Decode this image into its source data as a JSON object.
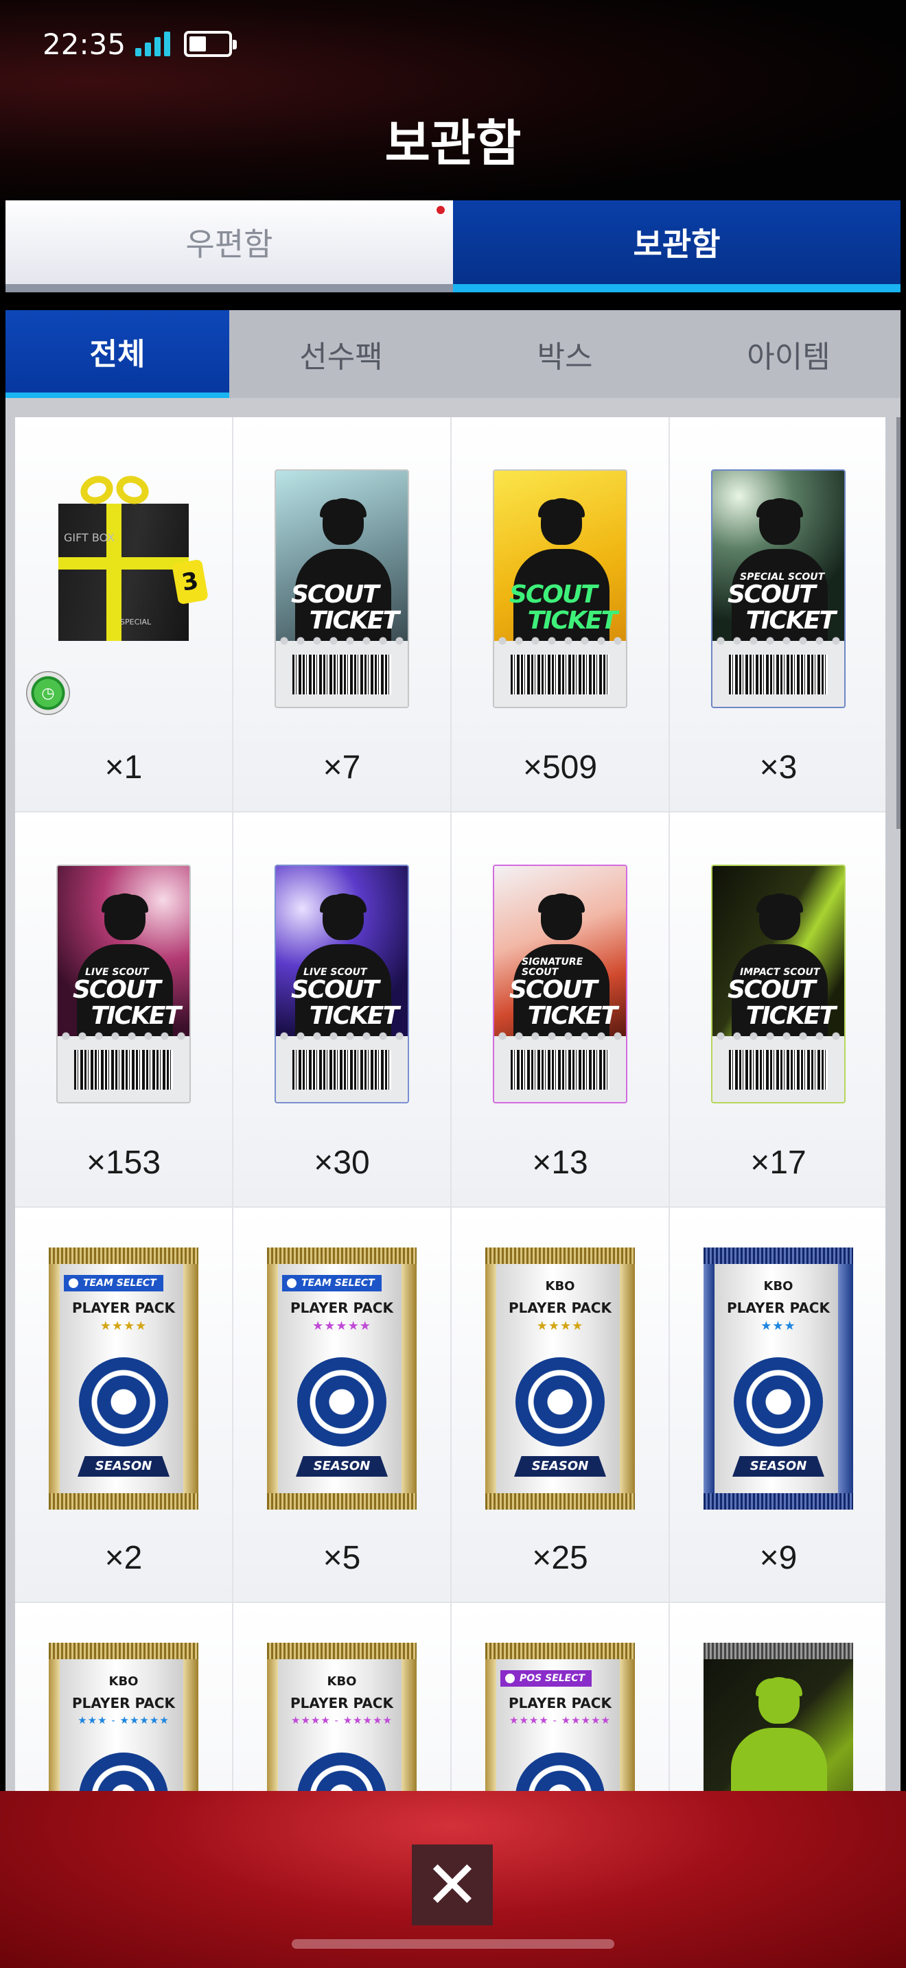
{
  "status_bar": {
    "time": "22:35"
  },
  "page_title": "보관함",
  "main_tabs": [
    {
      "label": "우편함",
      "active": false,
      "has_notification": true
    },
    {
      "label": "보관함",
      "active": true,
      "has_notification": false
    }
  ],
  "sub_tabs": [
    {
      "label": "전체",
      "active": true
    },
    {
      "label": "선수팩",
      "active": false
    },
    {
      "label": "박스",
      "active": false
    },
    {
      "label": "아이템",
      "active": false
    }
  ],
  "items": [
    {
      "kind": "gift-box",
      "box_text": "GIFT BOX",
      "box_sub": "SPECIAL",
      "badge": "3",
      "qty": "×1"
    },
    {
      "kind": "scout-ticket",
      "line1": "SCOUT",
      "line2": "TICKET",
      "sub": "",
      "qty": "×7"
    },
    {
      "kind": "scout-ticket",
      "line1": "SCOUT",
      "line2": "TICKET",
      "sub": "",
      "qty": "×509"
    },
    {
      "kind": "scout-ticket",
      "line1": "SCOUT",
      "line2": "TICKET",
      "sub": "SPECIAL SCOUT",
      "qty": "×3"
    },
    {
      "kind": "scout-ticket",
      "line1": "SCOUT",
      "line2": "TICKET",
      "sub": "LIVE SCOUT",
      "qty": "×153"
    },
    {
      "kind": "scout-ticket",
      "line1": "SCOUT",
      "line2": "TICKET",
      "sub": "LIVE SCOUT",
      "qty": "×30"
    },
    {
      "kind": "scout-ticket",
      "line1": "SCOUT",
      "line2": "TICKET",
      "sub": "SIGNATURE SCOUT",
      "qty": "×13"
    },
    {
      "kind": "scout-ticket",
      "line1": "SCOUT",
      "line2": "TICKET",
      "sub": "IMPACT SCOUT",
      "qty": "×17"
    },
    {
      "kind": "player-pack",
      "tag": "TEAM SELECT",
      "kbo": "",
      "name": "PLAYER PACK",
      "stars": "★★★★",
      "footer": "SEASON",
      "qty": "×2"
    },
    {
      "kind": "player-pack",
      "tag": "TEAM SELECT",
      "kbo": "",
      "name": "PLAYER PACK",
      "stars": "★★★★★",
      "footer": "SEASON",
      "qty": "×5"
    },
    {
      "kind": "player-pack",
      "tag": "",
      "kbo": "KBO",
      "name": "PLAYER PACK",
      "stars": "★★★★",
      "footer": "SEASON",
      "qty": "×25"
    },
    {
      "kind": "player-pack",
      "tag": "",
      "kbo": "KBO",
      "name": "PLAYER PACK",
      "stars": "★★★",
      "footer": "SEASON",
      "qty": "×9"
    },
    {
      "kind": "player-pack",
      "tag": "",
      "kbo": "KBO",
      "name": "PLAYER PACK",
      "stars": "★★★ - ★★★★★",
      "footer": "",
      "qty": ""
    },
    {
      "kind": "player-pack",
      "tag": "",
      "kbo": "KBO",
      "name": "PLAYER PACK",
      "stars": "★★★★ - ★★★★★",
      "footer": "",
      "qty": ""
    },
    {
      "kind": "player-pack",
      "tag": "POS SELECT",
      "kbo": "",
      "name": "PLAYER PACK",
      "stars": "★★★★ - ★★★★★",
      "footer": "",
      "qty": ""
    },
    {
      "kind": "dark-pack",
      "qty": ""
    }
  ],
  "close_button": {
    "label": "✕"
  },
  "colors": {
    "tab_active": "#0737a0",
    "tab_underline": "#19b4f2",
    "notification_dot": "#d8202a",
    "bottom_bar": "#9f0f18"
  }
}
